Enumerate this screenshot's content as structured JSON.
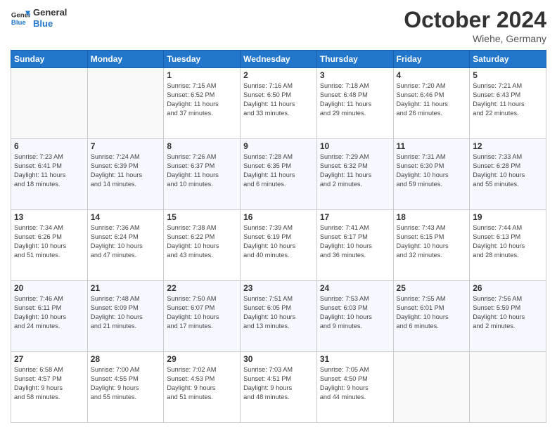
{
  "header": {
    "logo_line1": "General",
    "logo_line2": "Blue",
    "month": "October 2024",
    "location": "Wiehe, Germany"
  },
  "days_of_week": [
    "Sunday",
    "Monday",
    "Tuesday",
    "Wednesday",
    "Thursday",
    "Friday",
    "Saturday"
  ],
  "weeks": [
    [
      {
        "day": "",
        "info": ""
      },
      {
        "day": "",
        "info": ""
      },
      {
        "day": "1",
        "info": "Sunrise: 7:15 AM\nSunset: 6:52 PM\nDaylight: 11 hours\nand 37 minutes."
      },
      {
        "day": "2",
        "info": "Sunrise: 7:16 AM\nSunset: 6:50 PM\nDaylight: 11 hours\nand 33 minutes."
      },
      {
        "day": "3",
        "info": "Sunrise: 7:18 AM\nSunset: 6:48 PM\nDaylight: 11 hours\nand 29 minutes."
      },
      {
        "day": "4",
        "info": "Sunrise: 7:20 AM\nSunset: 6:46 PM\nDaylight: 11 hours\nand 26 minutes."
      },
      {
        "day": "5",
        "info": "Sunrise: 7:21 AM\nSunset: 6:43 PM\nDaylight: 11 hours\nand 22 minutes."
      }
    ],
    [
      {
        "day": "6",
        "info": "Sunrise: 7:23 AM\nSunset: 6:41 PM\nDaylight: 11 hours\nand 18 minutes."
      },
      {
        "day": "7",
        "info": "Sunrise: 7:24 AM\nSunset: 6:39 PM\nDaylight: 11 hours\nand 14 minutes."
      },
      {
        "day": "8",
        "info": "Sunrise: 7:26 AM\nSunset: 6:37 PM\nDaylight: 11 hours\nand 10 minutes."
      },
      {
        "day": "9",
        "info": "Sunrise: 7:28 AM\nSunset: 6:35 PM\nDaylight: 11 hours\nand 6 minutes."
      },
      {
        "day": "10",
        "info": "Sunrise: 7:29 AM\nSunset: 6:32 PM\nDaylight: 11 hours\nand 2 minutes."
      },
      {
        "day": "11",
        "info": "Sunrise: 7:31 AM\nSunset: 6:30 PM\nDaylight: 10 hours\nand 59 minutes."
      },
      {
        "day": "12",
        "info": "Sunrise: 7:33 AM\nSunset: 6:28 PM\nDaylight: 10 hours\nand 55 minutes."
      }
    ],
    [
      {
        "day": "13",
        "info": "Sunrise: 7:34 AM\nSunset: 6:26 PM\nDaylight: 10 hours\nand 51 minutes."
      },
      {
        "day": "14",
        "info": "Sunrise: 7:36 AM\nSunset: 6:24 PM\nDaylight: 10 hours\nand 47 minutes."
      },
      {
        "day": "15",
        "info": "Sunrise: 7:38 AM\nSunset: 6:22 PM\nDaylight: 10 hours\nand 43 minutes."
      },
      {
        "day": "16",
        "info": "Sunrise: 7:39 AM\nSunset: 6:19 PM\nDaylight: 10 hours\nand 40 minutes."
      },
      {
        "day": "17",
        "info": "Sunrise: 7:41 AM\nSunset: 6:17 PM\nDaylight: 10 hours\nand 36 minutes."
      },
      {
        "day": "18",
        "info": "Sunrise: 7:43 AM\nSunset: 6:15 PM\nDaylight: 10 hours\nand 32 minutes."
      },
      {
        "day": "19",
        "info": "Sunrise: 7:44 AM\nSunset: 6:13 PM\nDaylight: 10 hours\nand 28 minutes."
      }
    ],
    [
      {
        "day": "20",
        "info": "Sunrise: 7:46 AM\nSunset: 6:11 PM\nDaylight: 10 hours\nand 24 minutes."
      },
      {
        "day": "21",
        "info": "Sunrise: 7:48 AM\nSunset: 6:09 PM\nDaylight: 10 hours\nand 21 minutes."
      },
      {
        "day": "22",
        "info": "Sunrise: 7:50 AM\nSunset: 6:07 PM\nDaylight: 10 hours\nand 17 minutes."
      },
      {
        "day": "23",
        "info": "Sunrise: 7:51 AM\nSunset: 6:05 PM\nDaylight: 10 hours\nand 13 minutes."
      },
      {
        "day": "24",
        "info": "Sunrise: 7:53 AM\nSunset: 6:03 PM\nDaylight: 10 hours\nand 9 minutes."
      },
      {
        "day": "25",
        "info": "Sunrise: 7:55 AM\nSunset: 6:01 PM\nDaylight: 10 hours\nand 6 minutes."
      },
      {
        "day": "26",
        "info": "Sunrise: 7:56 AM\nSunset: 5:59 PM\nDaylight: 10 hours\nand 2 minutes."
      }
    ],
    [
      {
        "day": "27",
        "info": "Sunrise: 6:58 AM\nSunset: 4:57 PM\nDaylight: 9 hours\nand 58 minutes."
      },
      {
        "day": "28",
        "info": "Sunrise: 7:00 AM\nSunset: 4:55 PM\nDaylight: 9 hours\nand 55 minutes."
      },
      {
        "day": "29",
        "info": "Sunrise: 7:02 AM\nSunset: 4:53 PM\nDaylight: 9 hours\nand 51 minutes."
      },
      {
        "day": "30",
        "info": "Sunrise: 7:03 AM\nSunset: 4:51 PM\nDaylight: 9 hours\nand 48 minutes."
      },
      {
        "day": "31",
        "info": "Sunrise: 7:05 AM\nSunset: 4:50 PM\nDaylight: 9 hours\nand 44 minutes."
      },
      {
        "day": "",
        "info": ""
      },
      {
        "day": "",
        "info": ""
      }
    ]
  ]
}
